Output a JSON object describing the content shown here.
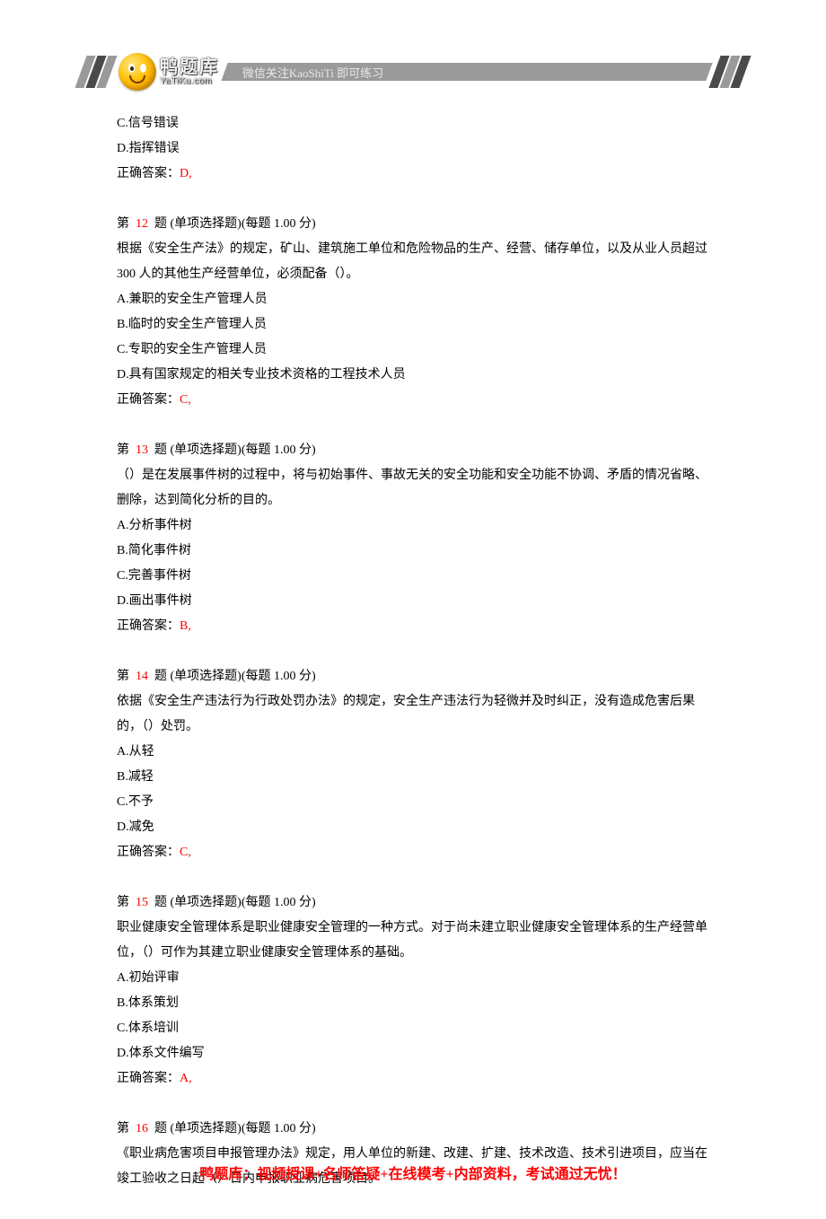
{
  "header": {
    "logo_cn": "鸭题库",
    "logo_en": "YaTiKu.com",
    "bar_text": "微信关注KaoShiTi 即可练习"
  },
  "prev_question_tail": {
    "option_c": "C.信号错误",
    "option_d": "D.指挥错误",
    "answer_label": "正确答案：",
    "answer_value": "D,"
  },
  "questions": [
    {
      "prefix": "第  ",
      "num": "12",
      "suffix": "  题 (单项选择题)(每题 1.00 分)",
      "stem": "根据《安全生产法》的规定，矿山、建筑施工单位和危险物品的生产、经营、储存单位，以及从业人员超过 300 人的其他生产经营单位，必须配备（）。",
      "a": "A.兼职的安全生产管理人员",
      "b": "B.临时的安全生产管理人员",
      "c": "C.专职的安全生产管理人员",
      "d": "D.具有国家规定的相关专业技术资格的工程技术人员",
      "answer_label": "正确答案：",
      "answer_value": "C,"
    },
    {
      "prefix": "第  ",
      "num": "13",
      "suffix": "  题 (单项选择题)(每题 1.00 分)",
      "stem": "（）是在发展事件树的过程中，将与初始事件、事故无关的安全功能和安全功能不协调、矛盾的情况省略、删除，达到简化分析的目的。",
      "a": "A.分析事件树",
      "b": "B.简化事件树",
      "c": "C.完善事件树",
      "d": "D.画出事件树",
      "answer_label": "正确答案：",
      "answer_value": "B,"
    },
    {
      "prefix": "第  ",
      "num": "14",
      "suffix": "  题 (单项选择题)(每题 1.00 分)",
      "stem": "依据《安全生产违法行为行政处罚办法》的规定，安全生产违法行为轻微并及时纠正，没有造成危害后果的，（）处罚。",
      "a": "A.从轻",
      "b": "B.减轻",
      "c": "C.不予",
      "d": "D.减免",
      "answer_label": "正确答案：",
      "answer_value": "C,"
    },
    {
      "prefix": "第  ",
      "num": "15",
      "suffix": "  题 (单项选择题)(每题 1.00 分)",
      "stem": "职业健康安全管理体系是职业健康安全管理的一种方式。对于尚未建立职业健康安全管理体系的生产经营单位，（）可作为其建立职业健康安全管理体系的基础。",
      "a": "A.初始评审",
      "b": "B.体系策划",
      "c": "C.体系培训",
      "d": "D.体系文件编写",
      "answer_label": "正确答案：",
      "answer_value": "A,"
    },
    {
      "prefix": "第  ",
      "num": "16",
      "suffix": "  题 (单项选择题)(每题 1.00 分)",
      "stem": "《职业病危害项目申报管理办法》规定，用人单位的新建、改建、扩建、技术改造、技术引进项目，应当在竣工验收之日起（）日内申报职业病危害项目。",
      "a": "",
      "b": "",
      "c": "",
      "d": "",
      "answer_label": "",
      "answer_value": ""
    }
  ],
  "footer": "鸭题库：视频授课+名师答疑+在线模考+内部资料，考试通过无忧！"
}
